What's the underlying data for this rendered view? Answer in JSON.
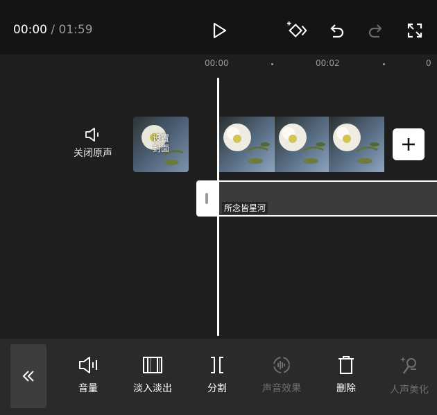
{
  "header": {
    "current_time": "00:00",
    "separator": " / ",
    "total_time": "01:59"
  },
  "timeline": {
    "ruler_labels": [
      "00:00",
      "00:02"
    ],
    "mute_label": "关闭原声",
    "cover_label_line1": "设置",
    "cover_label_line2": "封面",
    "audio_track_name": "所念皆星河"
  },
  "toolbar": {
    "tools": [
      {
        "label": "音量",
        "icon": "volume-icon",
        "enabled": true
      },
      {
        "label": "淡入淡出",
        "icon": "fade-icon",
        "enabled": true
      },
      {
        "label": "分割",
        "icon": "split-icon",
        "enabled": true
      },
      {
        "label": "声音效果",
        "icon": "voice-effect-icon",
        "enabled": false
      },
      {
        "label": "删除",
        "icon": "delete-icon",
        "enabled": true
      },
      {
        "label": "人声美化",
        "icon": "vocal-enhance-icon",
        "enabled": false
      }
    ]
  },
  "colors": {
    "background": "#1e1e1e",
    "topbar": "#141414",
    "toolbar": "#2a2a2a",
    "disabled_text": "#6e6e6e",
    "accent": "#ffffff"
  }
}
